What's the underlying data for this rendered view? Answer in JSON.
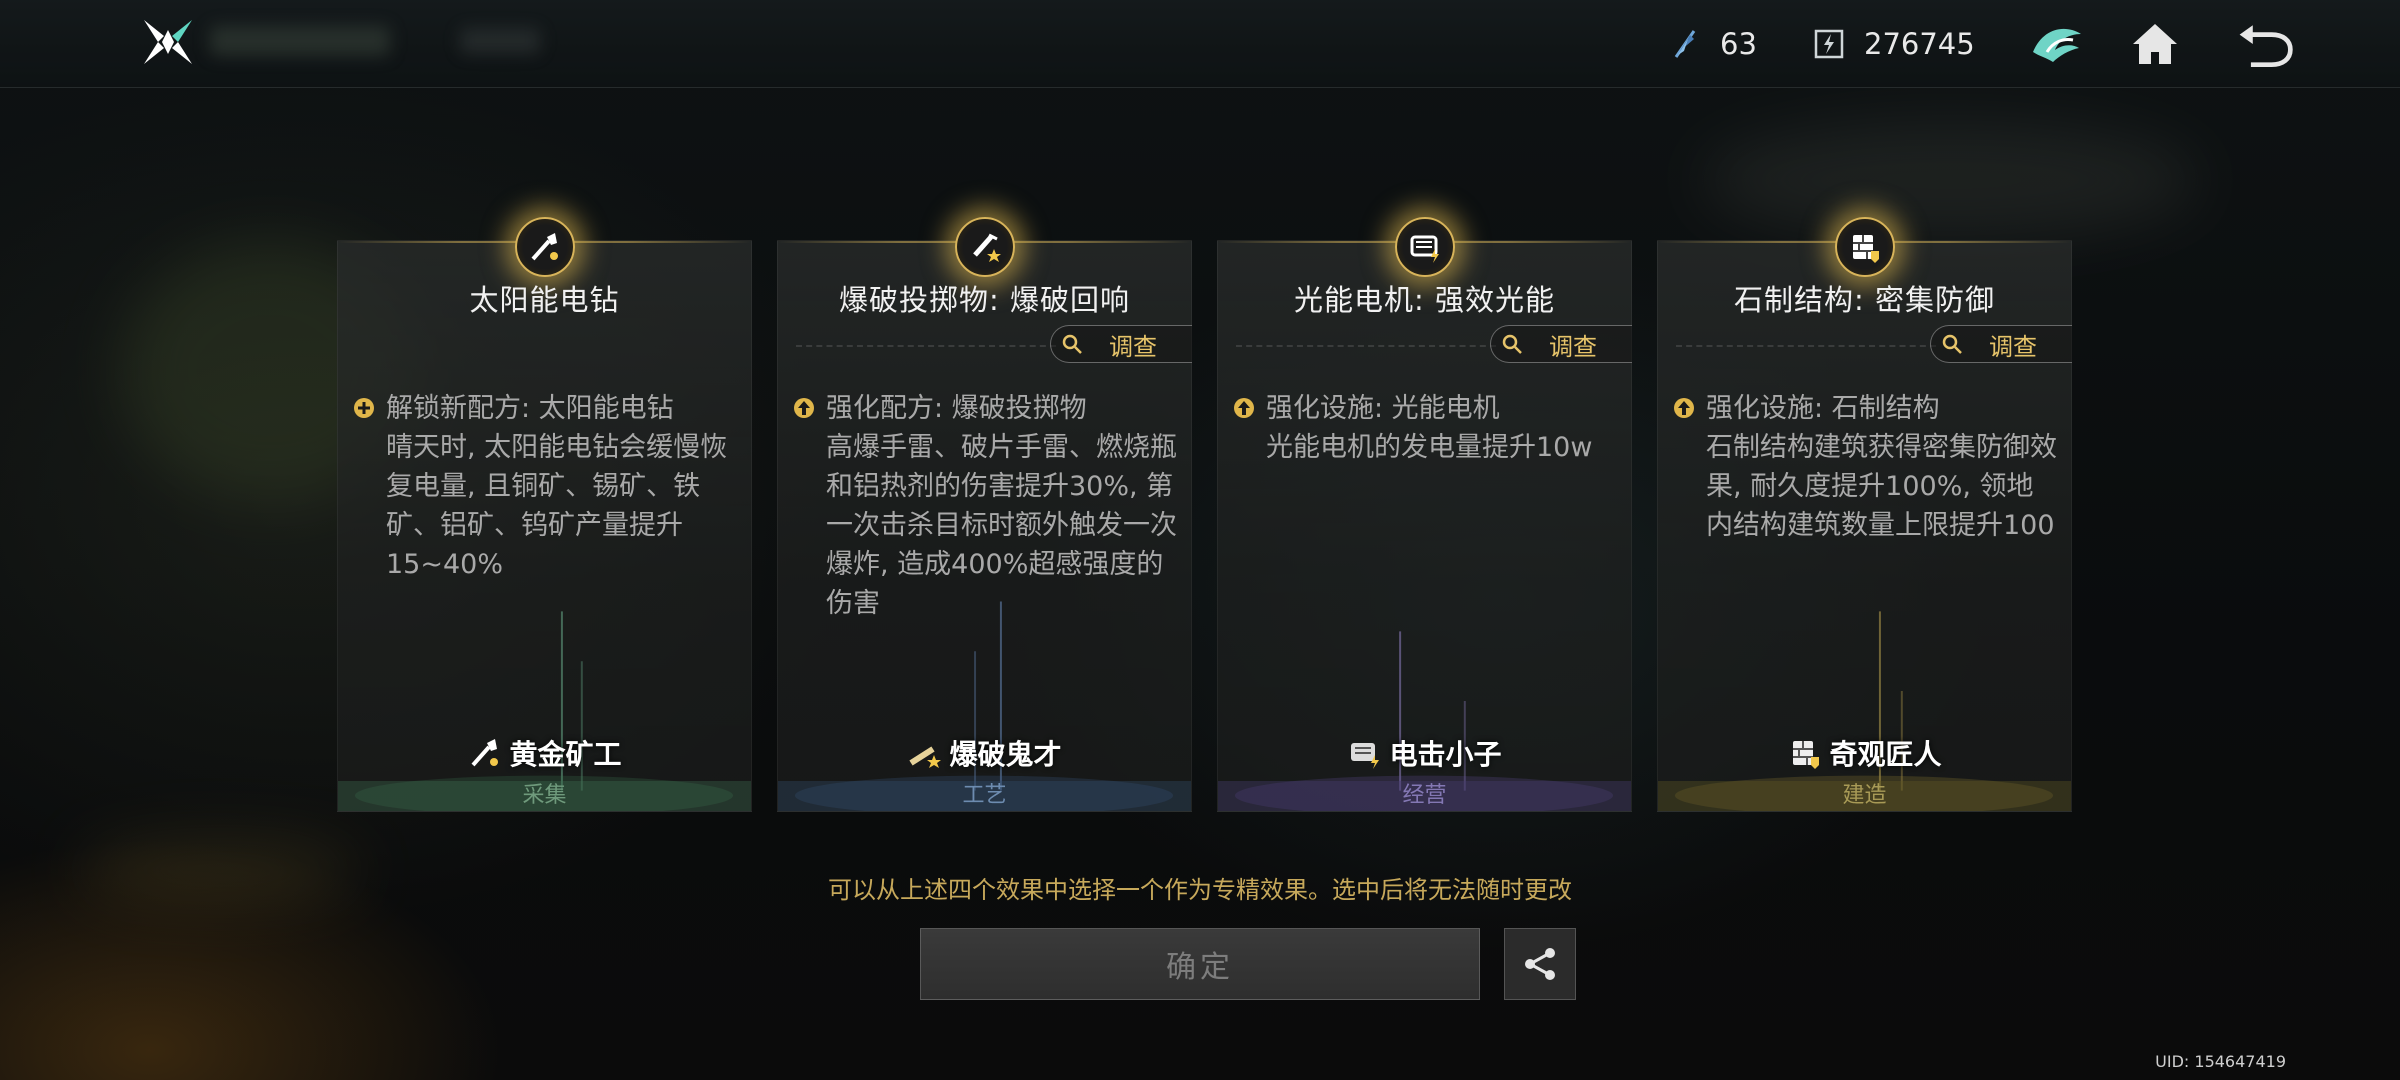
{
  "topbar": {
    "currencies": [
      {
        "icon": "feather-currency-icon",
        "value": "63"
      },
      {
        "icon": "energy-currency-icon",
        "value": "276745"
      }
    ]
  },
  "cards": [
    {
      "title": "太阳能电钻",
      "has_investigate": false,
      "effect_type": "unlock",
      "effect_head": "解锁新配方: 太阳能电钻",
      "effect_desc": "晴天时, 太阳能电钻会缓慢恢复电量, 且铜矿、锡矿、铁矿、铝矿、钨矿产量提升15~40%",
      "role": "黄金矿工",
      "category": "采集",
      "category_color": "#3f6f52",
      "text_color": "#6f9a7c"
    },
    {
      "title": "爆破投掷物: 爆破回响",
      "has_investigate": true,
      "effect_type": "upgrade",
      "effect_head": "强化配方: 爆破投掷物",
      "effect_desc": "高爆手雷、破片手雷、燃烧瓶和铝热剂的伤害提升30%, 第一次击杀目标时额外触发一次爆炸, 造成400%超感强度的伤害",
      "role": "爆破鬼才",
      "category": "工艺",
      "category_color": "#34506f",
      "text_color": "#6d8cb0"
    },
    {
      "title": "光能电机: 强效光能",
      "has_investigate": true,
      "effect_type": "upgrade",
      "effect_head": "强化设施: 光能电机",
      "effect_desc": "光能电机的发电量提升10w",
      "role": "电击小子",
      "category": "经营",
      "category_color": "#463d6e",
      "text_color": "#8478b4"
    },
    {
      "title": "石制结构: 密集防御",
      "has_investigate": true,
      "effect_type": "upgrade",
      "effect_head": "强化设施: 石制结构",
      "effect_desc": "石制结构建筑获得密集防御效果, 耐久度提升100%, 领地内结构建筑数量上限提升100",
      "role": "奇观匠人",
      "category": "建造",
      "category_color": "#5c5424",
      "text_color": "#a89a56"
    }
  ],
  "investigate_label": "调查",
  "hint": "可以从上述四个效果中选择一个作为专精效果。选中后将无法随时更改",
  "confirm_label": "确定",
  "uid": "UID: 154647419",
  "colors": {
    "gold": "#e7c46a",
    "accent_teal": "#5fd6c2"
  }
}
